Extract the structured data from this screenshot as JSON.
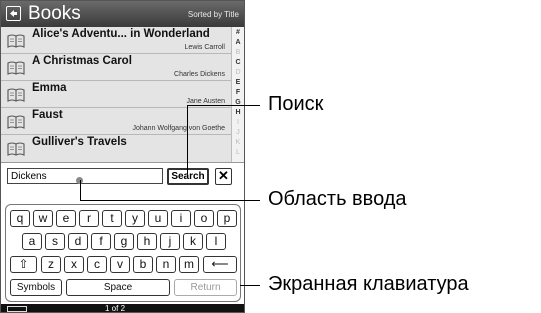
{
  "header": {
    "title": "Books",
    "sort_label": "Sorted by Title"
  },
  "books": [
    {
      "title": "Alice's Adventu... in Wonderland",
      "author": "Lewis Carroll"
    },
    {
      "title": "A Christmas Carol",
      "author": "Charles Dickens"
    },
    {
      "title": "Emma",
      "author": "Jane Austen"
    },
    {
      "title": "Faust",
      "author": "Johann Wolfgang von Goethe"
    },
    {
      "title": "Gulliver's Travels",
      "author": ""
    }
  ],
  "alphabet": [
    "#",
    "A",
    "B",
    "C",
    "D",
    "E",
    "F",
    "G",
    "H",
    "I",
    "J",
    "K",
    "L"
  ],
  "search": {
    "value": "Dickens",
    "button_label": "Search",
    "close_label": "✕"
  },
  "keyboard": {
    "row1": [
      "q",
      "w",
      "e",
      "r",
      "t",
      "y",
      "u",
      "i",
      "o",
      "p"
    ],
    "row2": [
      "a",
      "s",
      "d",
      "f",
      "g",
      "h",
      "j",
      "k",
      "l"
    ],
    "row3": [
      "z",
      "x",
      "c",
      "v",
      "b",
      "n",
      "m"
    ],
    "shift_label": "⇧",
    "backspace_label": "⟵",
    "symbols_label": "Symbols",
    "space_label": "Space",
    "return_label": "Return"
  },
  "status": {
    "page": "1 of 2"
  },
  "callouts": {
    "search": "Поиск",
    "input_area": "Область ввода",
    "keyboard": "Экранная клавиатура"
  }
}
